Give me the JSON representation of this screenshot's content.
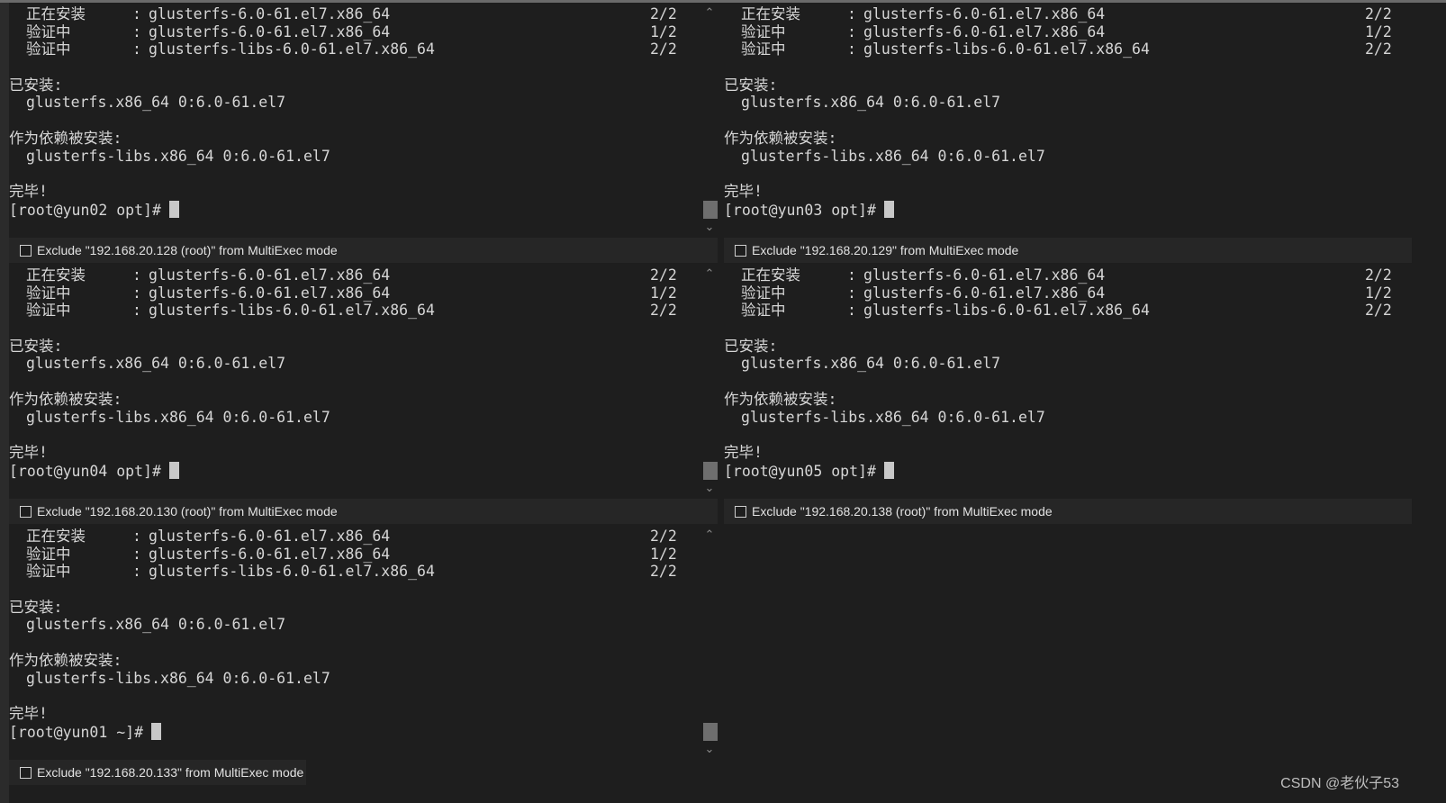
{
  "panes": [
    {
      "id": "p1",
      "lines": [
        {
          "name": "正在安装",
          "pkg": "glusterfs-6.0-61.el7.x86_64",
          "count": "2/2"
        },
        {
          "name": "验证中",
          "pkg": "glusterfs-6.0-61.el7.x86_64",
          "count": "1/2"
        },
        {
          "name": "验证中",
          "pkg": "glusterfs-libs-6.0-61.el7.x86_64",
          "count": "2/2"
        }
      ],
      "installed_label": "已安装:",
      "installed_pkg": "glusterfs.x86_64 0:6.0-61.el7",
      "dep_label": "作为依赖被安装:",
      "dep_pkg": "glusterfs-libs.x86_64 0:6.0-61.el7",
      "done": "完毕!",
      "prompt": "[root@yun02 opt]#",
      "exclude": "Exclude \"192.168.20.128 (root)\" from MultiExec mode"
    },
    {
      "id": "p2",
      "lines": [
        {
          "name": "正在安装",
          "pkg": "glusterfs-6.0-61.el7.x86_64",
          "count": "2/2"
        },
        {
          "name": "验证中",
          "pkg": "glusterfs-6.0-61.el7.x86_64",
          "count": "1/2"
        },
        {
          "name": "验证中",
          "pkg": "glusterfs-libs-6.0-61.el7.x86_64",
          "count": "2/2"
        }
      ],
      "installed_label": "已安装:",
      "installed_pkg": "glusterfs.x86_64 0:6.0-61.el7",
      "dep_label": "作为依赖被安装:",
      "dep_pkg": "glusterfs-libs.x86_64 0:6.0-61.el7",
      "done": "完毕!",
      "prompt": "[root@yun03 opt]#",
      "exclude": "Exclude \"192.168.20.129\" from MultiExec mode"
    },
    {
      "id": "p3",
      "lines": [
        {
          "name": "正在安装",
          "pkg": "glusterfs-6.0-61.el7.x86_64",
          "count": "2/2"
        },
        {
          "name": "验证中",
          "pkg": "glusterfs-6.0-61.el7.x86_64",
          "count": "1/2"
        },
        {
          "name": "验证中",
          "pkg": "glusterfs-libs-6.0-61.el7.x86_64",
          "count": "2/2"
        }
      ],
      "installed_label": "已安装:",
      "installed_pkg": "glusterfs.x86_64 0:6.0-61.el7",
      "dep_label": "作为依赖被安装:",
      "dep_pkg": "glusterfs-libs.x86_64 0:6.0-61.el7",
      "done": "完毕!",
      "prompt": "[root@yun04 opt]#",
      "exclude": "Exclude \"192.168.20.130 (root)\" from MultiExec mode"
    },
    {
      "id": "p4",
      "lines": [
        {
          "name": "正在安装",
          "pkg": "glusterfs-6.0-61.el7.x86_64",
          "count": "2/2"
        },
        {
          "name": "验证中",
          "pkg": "glusterfs-6.0-61.el7.x86_64",
          "count": "1/2"
        },
        {
          "name": "验证中",
          "pkg": "glusterfs-libs-6.0-61.el7.x86_64",
          "count": "2/2"
        }
      ],
      "installed_label": "已安装:",
      "installed_pkg": "glusterfs.x86_64 0:6.0-61.el7",
      "dep_label": "作为依赖被安装:",
      "dep_pkg": "glusterfs-libs.x86_64 0:6.0-61.el7",
      "done": "完毕!",
      "prompt": "[root@yun05 opt]#",
      "exclude": "Exclude \"192.168.20.138 (root)\" from MultiExec mode"
    },
    {
      "id": "p5",
      "lines": [
        {
          "name": "正在安装",
          "pkg": "glusterfs-6.0-61.el7.x86_64",
          "count": "2/2"
        },
        {
          "name": "验证中",
          "pkg": "glusterfs-6.0-61.el7.x86_64",
          "count": "1/2"
        },
        {
          "name": "验证中",
          "pkg": "glusterfs-libs-6.0-61.el7.x86_64",
          "count": "2/2"
        }
      ],
      "installed_label": "已安装:",
      "installed_pkg": "glusterfs.x86_64 0:6.0-61.el7",
      "dep_label": "作为依赖被安装:",
      "dep_pkg": "glusterfs-libs.x86_64 0:6.0-61.el7",
      "done": "完毕!",
      "prompt": "[root@yun01 ~]#",
      "exclude": "Exclude \"192.168.20.133\" from MultiExec mode"
    }
  ],
  "scrollbar": {
    "up": "⌃",
    "down": "⌄"
  },
  "watermark": "CSDN @老伙子53"
}
